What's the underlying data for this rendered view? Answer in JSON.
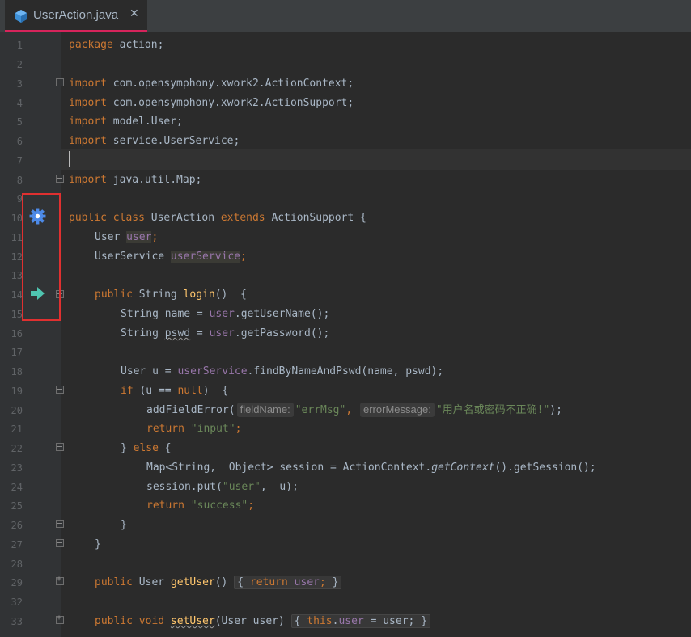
{
  "tab": {
    "title": "UserAction.java",
    "icon": "java-class-icon"
  },
  "gutter": {
    "line_numbers": [
      "1",
      "2",
      "3",
      "4",
      "5",
      "6",
      "7",
      "8",
      "9",
      "10",
      "11",
      "12",
      "13",
      "14",
      "15",
      "16",
      "17",
      "18",
      "19",
      "20",
      "21",
      "22",
      "23",
      "24",
      "25",
      "26",
      "27",
      "28",
      "29",
      "32",
      "33"
    ],
    "icons": [
      "gear-icon",
      "arrow-right-icon"
    ]
  },
  "code": {
    "l1": {
      "kw": "package",
      "rest": " action;"
    },
    "l3": {
      "kw": "import",
      "rest": " com.opensymphony.xwork2.ActionContext;"
    },
    "l4": {
      "kw": "import",
      "rest": " com.opensymphony.xwork2.ActionSupport;"
    },
    "l5": {
      "kw": "import",
      "rest": " model.User;"
    },
    "l6": {
      "kw": "import",
      "rest": " service.UserService;"
    },
    "l8": {
      "kw": "import",
      "rest": " java.util.Map;"
    },
    "l10": {
      "kw1": "public class",
      "name": " UserAction ",
      "kw2": "extends",
      "rest": " ActionSupport {"
    },
    "l11": {
      "type": "User ",
      "field": "user",
      "end": ";"
    },
    "l12": {
      "type": "UserService ",
      "field": "userService",
      "end": ";"
    },
    "l14": {
      "kw": "public",
      "type": " String ",
      "meth": "login",
      "rest": "()  {"
    },
    "l15": {
      "pre": "String name = ",
      "field": "user",
      "rest": ".getUserName();"
    },
    "l16": {
      "pre1": "String ",
      "var": "pswd",
      "pre2": " = ",
      "field": "user",
      "rest": ".getPassword();"
    },
    "l18": {
      "pre": "User u = ",
      "field": "userService",
      "rest": ".findByNameAndPswd(name, pswd);"
    },
    "l19": {
      "kw": "if",
      "mid": " (u == ",
      "kw2": "null",
      "rest": ")  {"
    },
    "l20": {
      "call": "addFieldError(",
      "hint1": "fieldName:",
      "str1": "\"errMsg\"",
      "comma": ",",
      "hint2": "errorMessage:",
      "str2": "\"用户名或密码不正确!\"",
      "end": ");"
    },
    "l21": {
      "kw": "return",
      "str": " \"input\"",
      "end": ";"
    },
    "l22": {
      "brace": "} ",
      "kw": "else",
      "rest": " {"
    },
    "l23": {
      "pre": "Map<String,  Object> session = ActionContext.",
      "ital": "getContext",
      "rest": "().getSession();"
    },
    "l24": {
      "pre": "session.put(",
      "str": "\"user\"",
      "rest": ",  u);"
    },
    "l25": {
      "kw": "return",
      "str": " \"success\"",
      "end": ";"
    },
    "l26": {
      "text": "}"
    },
    "l27": {
      "text": "}"
    },
    "l29": {
      "kw": "public",
      "type": " User ",
      "meth": "getUser",
      "paren": "()",
      "ob": "{",
      "kw2": "return",
      "field": " user",
      "semi": ";",
      "cb": "}"
    },
    "l33": {
      "kw": "public void ",
      "meth": "setUser",
      "params": "(User user)",
      "ob": "{",
      "kw2": "this",
      "dot": ".",
      "field": "user",
      "assign": " = user;",
      "cb": "}"
    }
  },
  "colors": {
    "keyword": "#cc7832",
    "field": "#9876aa",
    "string": "#6a8759",
    "method": "#ffc66d",
    "text": "#a9b7c6",
    "tab_accent": "#d6245b",
    "highlight_box": "#e03030"
  }
}
